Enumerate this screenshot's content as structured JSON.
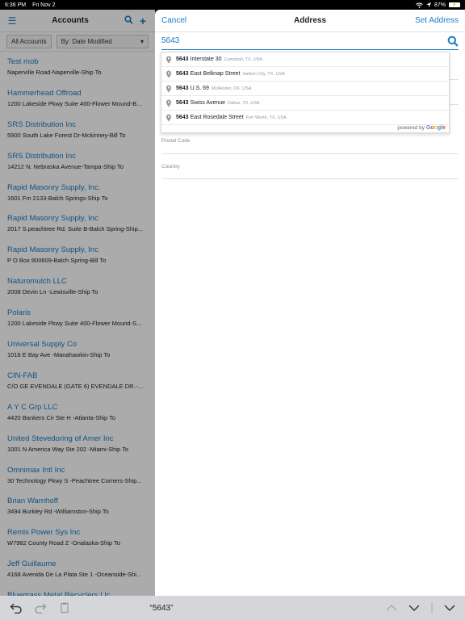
{
  "status_bar": {
    "time": "6:36 PM",
    "date": "Fri Nov 2",
    "battery": "87%"
  },
  "accounts_pane": {
    "title": "Accounts",
    "filter_all": "All Accounts",
    "sort_label": "By: Date Modified",
    "accounts": [
      {
        "name": "Test mob",
        "address": "Naperville Road-Naperville-Ship To"
      },
      {
        "name": "Hammerhead Offroad",
        "address": "1200 Lakeside Pkwy Suite 400-Flower Mound-B..."
      },
      {
        "name": "SRS Distribution Inc",
        "address": "5900 South Lake Forest Dr-Mckinney-Bill To"
      },
      {
        "name": "SRS Distribution Inc",
        "address": "14212 N. Nebraska Avenue-Tampa-Ship To"
      },
      {
        "name": "Rapid Masonry Supply, Inc.",
        "address": "1601 Fm 2133-Balch Springs-Ship To"
      },
      {
        "name": "Rapid Masonry Supply, Inc",
        "address": "2017 S.peachtree Rd. Suite B-Balch Spring-Ship..."
      },
      {
        "name": "Rapid Masonry Supply, Inc",
        "address": "P O Box 800609-Balch Spring-Bill To"
      },
      {
        "name": "Naturomulch LLC",
        "address": "2008 Devin Ln -Lewisville-Ship To"
      },
      {
        "name": "Polaris",
        "address": "1200 Lakeside Pkwy Suite 400-Flower Mound-S..."
      },
      {
        "name": "Universal Supply Co",
        "address": "1016 E Bay Ave -Manahawkin-Ship To"
      },
      {
        "name": "CIN-FAB",
        "address": "C/O GE EVENDALE (GATE 6) EVENDALE DR.-CIN..."
      },
      {
        "name": "A Y C Grp LLC",
        "address": "4420 Bankers Cir Ste H -Atlanta-Ship To"
      },
      {
        "name": "United Stevedoring of Amer Inc",
        "address": "1001 N America Way Ste 202 -Miami-Ship To"
      },
      {
        "name": "Omnimax Intl Inc",
        "address": "30 Technology Pkwy S -Peachtree Corners-Ship..."
      },
      {
        "name": "Brian Warnhoff",
        "address": "3494 Burkley Rd -Williamston-Ship To"
      },
      {
        "name": "Remis Power Sys Inc",
        "address": "W7982 County Road Z -Onalaska-Ship To"
      },
      {
        "name": "Jeff Guillaume",
        "address": "4168 Avenida De La Plata Ste 1 -Oceanside-Shi..."
      },
      {
        "name": "Bluegrass Metal Recyclers Llc",
        "address": ""
      }
    ]
  },
  "address_pane": {
    "cancel_label": "Cancel",
    "title": "Address",
    "set_label": "Set Address",
    "search_value": "5643",
    "postal_label": "Postal Code",
    "country_label": "Country"
  },
  "suggestions": [
    {
      "number": "5643",
      "street": "Interstate 30",
      "city": "Campbell, TX, USA"
    },
    {
      "number": "5643",
      "street": "East Belknap Street",
      "city": "Haltom City, TX, USA"
    },
    {
      "number": "5643",
      "street": "U.S. 69",
      "city": "McAlester, OK, USA"
    },
    {
      "number": "5643",
      "street": "Swiss Avenue",
      "city": "Dallas, TX, USA"
    },
    {
      "number": "5643",
      "street": "East Rosedale Street",
      "city": "Fort Worth, TX, USA"
    }
  ],
  "powered_by": "powered by",
  "google_letters": [
    "G",
    "o",
    "o",
    "g",
    "l",
    "e"
  ],
  "google_colors": [
    "#4285f4",
    "#ea4335",
    "#fbbc05",
    "#4285f4",
    "#34a853",
    "#ea4335"
  ],
  "keyboard_toolbar": {
    "suggestion": "“5643”"
  },
  "colors": {
    "accent": "#1a7bc4"
  }
}
